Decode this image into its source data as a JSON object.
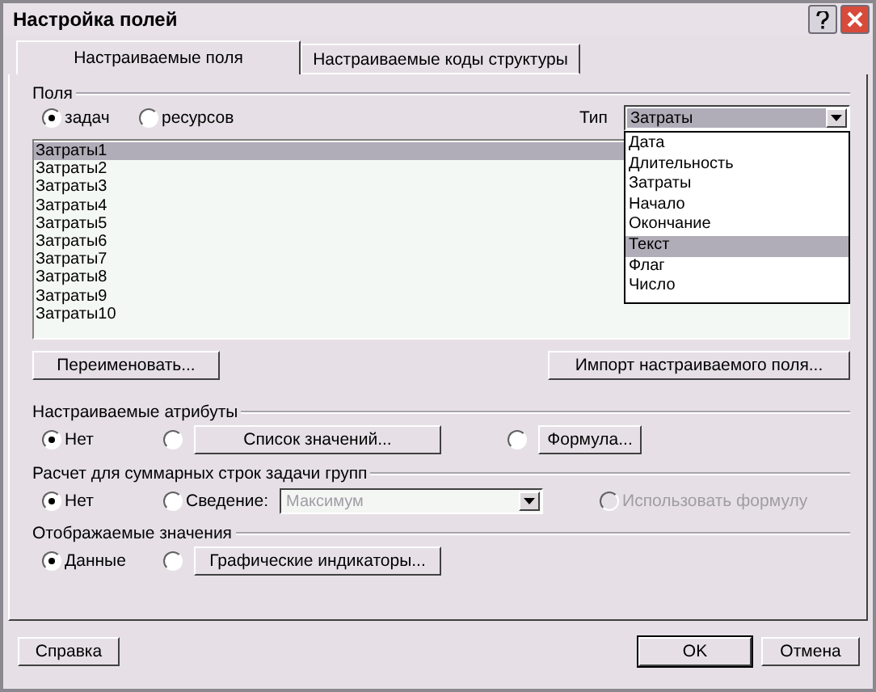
{
  "window": {
    "title": "Настройка полей"
  },
  "tabs": [
    {
      "label": "Настраиваемые поля",
      "selected": true
    },
    {
      "label": "Настраиваемые коды структуры",
      "selected": false
    }
  ],
  "fields": {
    "label": "Поля",
    "scope": [
      {
        "label": "задач",
        "selected": true
      },
      {
        "label": "ресурсов",
        "selected": false
      }
    ],
    "type_label": "Тип",
    "type_value": "Затраты",
    "type_options": [
      {
        "label": "Дата",
        "selected": false
      },
      {
        "label": "Длительность",
        "selected": false
      },
      {
        "label": "Затраты",
        "selected": false
      },
      {
        "label": "Начало",
        "selected": false
      },
      {
        "label": "Окончание",
        "selected": false
      },
      {
        "label": "Текст",
        "selected": true
      },
      {
        "label": "Флаг",
        "selected": false
      },
      {
        "label": "Число",
        "selected": false
      }
    ],
    "items": [
      {
        "label": "Затраты1",
        "selected": true
      },
      {
        "label": "Затраты2",
        "selected": false
      },
      {
        "label": "Затраты3",
        "selected": false
      },
      {
        "label": "Затраты4",
        "selected": false
      },
      {
        "label": "Затраты5",
        "selected": false
      },
      {
        "label": "Затраты6",
        "selected": false
      },
      {
        "label": "Затраты7",
        "selected": false
      },
      {
        "label": "Затраты8",
        "selected": false
      },
      {
        "label": "Затраты9",
        "selected": false
      },
      {
        "label": "Затраты10",
        "selected": false
      }
    ],
    "rename_button": "Переименовать...",
    "import_button": "Импорт настраиваемого поля..."
  },
  "attributes": {
    "label": "Настраиваемые атрибуты",
    "options": [
      {
        "kind": "radio",
        "label": "Нет",
        "selected": true
      },
      {
        "kind": "button",
        "label": "Список значений...",
        "selected": false
      },
      {
        "kind": "button",
        "label": "Формула...",
        "selected": false
      }
    ]
  },
  "summary": {
    "label": "Расчет для суммарных строк задачи групп",
    "options": [
      {
        "kind": "radio",
        "label": "Нет",
        "selected": true,
        "disabled": false
      },
      {
        "kind": "combo",
        "label": "Сведение:",
        "value": "Максимум",
        "selected": false,
        "disabled": false,
        "combo_disabled": true
      },
      {
        "kind": "radio",
        "label": "Использовать формулу",
        "selected": false,
        "disabled": true
      }
    ]
  },
  "display": {
    "label": "Отображаемые значения",
    "options": [
      {
        "kind": "radio",
        "label": "Данные",
        "selected": true
      },
      {
        "kind": "button",
        "label": "Графические индикаторы...",
        "selected": false
      }
    ]
  },
  "footer": {
    "help_button": "Справка",
    "buttons": [
      {
        "label": "OK",
        "default": true
      },
      {
        "label": "Отмена",
        "default": false
      }
    ]
  }
}
